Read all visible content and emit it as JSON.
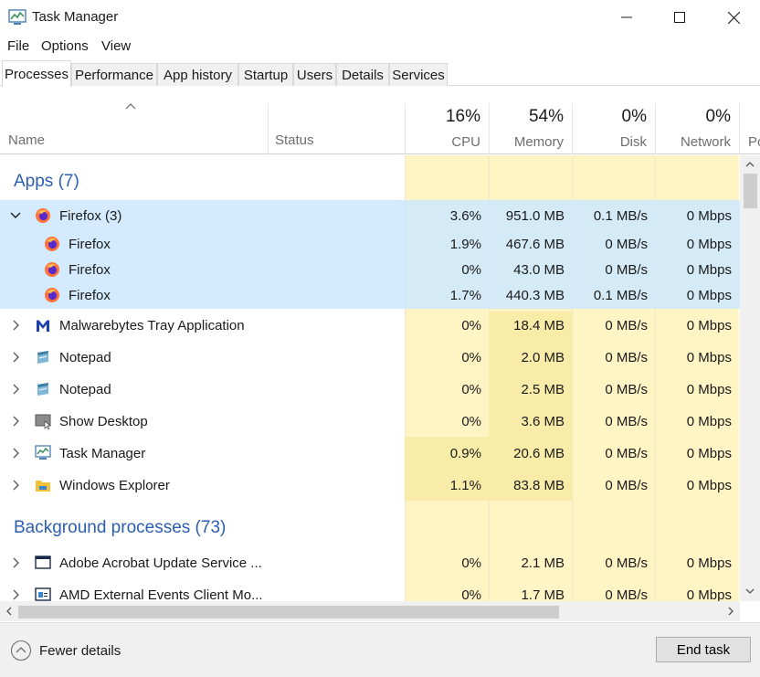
{
  "window": {
    "title": "Task Manager"
  },
  "menu": {
    "file": "File",
    "options": "Options",
    "view": "View"
  },
  "tabs": [
    "Processes",
    "Performance",
    "App history",
    "Startup",
    "Users",
    "Details",
    "Services"
  ],
  "columns": {
    "name": "Name",
    "status": "Status",
    "cpu": {
      "pct": "16%",
      "label": "CPU"
    },
    "memory": {
      "pct": "54%",
      "label": "Memory"
    },
    "disk": {
      "pct": "0%",
      "label": "Disk"
    },
    "network": {
      "pct": "0%",
      "label": "Network"
    },
    "power_partial": "Po"
  },
  "groups": {
    "apps": "Apps (7)",
    "background": "Background processes (73)"
  },
  "rows": [
    {
      "name": "Firefox (3)",
      "cpu": "3.6%",
      "memory": "951.0 MB",
      "disk": "0.1 MB/s",
      "network": "0 Mbps",
      "icon": "firefox-icon"
    },
    {
      "name": "Firefox",
      "cpu": "1.9%",
      "memory": "467.6 MB",
      "disk": "0 MB/s",
      "network": "0 Mbps",
      "icon": "firefox-icon"
    },
    {
      "name": "Firefox",
      "cpu": "0%",
      "memory": "43.0 MB",
      "disk": "0 MB/s",
      "network": "0 Mbps",
      "icon": "firefox-icon"
    },
    {
      "name": "Firefox",
      "cpu": "1.7%",
      "memory": "440.3 MB",
      "disk": "0.1 MB/s",
      "network": "0 Mbps",
      "icon": "firefox-icon"
    },
    {
      "name": "Malwarebytes Tray Application",
      "cpu": "0%",
      "memory": "18.4 MB",
      "disk": "0 MB/s",
      "network": "0 Mbps",
      "icon": "malwarebytes-icon"
    },
    {
      "name": "Notepad",
      "cpu": "0%",
      "memory": "2.0 MB",
      "disk": "0 MB/s",
      "network": "0 Mbps",
      "icon": "notepad-icon"
    },
    {
      "name": "Notepad",
      "cpu": "0%",
      "memory": "2.5 MB",
      "disk": "0 MB/s",
      "network": "0 Mbps",
      "icon": "notepad-icon"
    },
    {
      "name": "Show Desktop",
      "cpu": "0%",
      "memory": "3.6 MB",
      "disk": "0 MB/s",
      "network": "0 Mbps",
      "icon": "show-desktop-icon"
    },
    {
      "name": "Task Manager",
      "cpu": "0.9%",
      "memory": "20.6 MB",
      "disk": "0 MB/s",
      "network": "0 Mbps",
      "icon": "task-manager-icon"
    },
    {
      "name": "Windows Explorer",
      "cpu": "1.1%",
      "memory": "83.8 MB",
      "disk": "0 MB/s",
      "network": "0 Mbps",
      "icon": "folder-icon"
    },
    {
      "name": "Adobe Acrobat Update Service ...",
      "cpu": "0%",
      "memory": "2.1 MB",
      "disk": "0 MB/s",
      "network": "0 Mbps",
      "icon": "window-icon"
    },
    {
      "name": "AMD External Events Client Mo...",
      "cpu": "0%",
      "memory": "1.7 MB",
      "disk": "0 MB/s",
      "network": "0 Mbps",
      "icon": "service-icon"
    }
  ],
  "footer": {
    "fewer_details": "Fewer details",
    "end_task": "End task"
  },
  "colors": {
    "selection": "#cce8ff",
    "heat_light": "#fff4c4",
    "heat_mid": "#f9eca8",
    "group_title": "#2b5eb0"
  }
}
